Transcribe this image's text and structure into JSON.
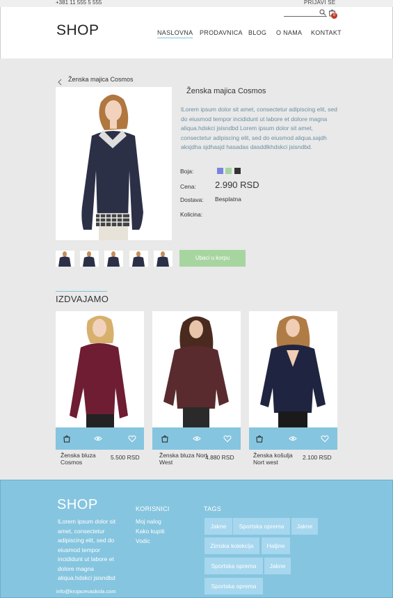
{
  "topbar": {
    "phone": "+381 11 555 5 555",
    "login": "PRIJAVI SE"
  },
  "header": {
    "logo": "SHOP",
    "cart_count": "0",
    "nav": [
      "NASLOVNA",
      "PRODAVNICA",
      "BLOG",
      "O NAMA",
      "KONTAKT"
    ],
    "active_nav": "NASLOVNA"
  },
  "product": {
    "breadcrumb": "Ženska majica Cosmos",
    "title": "Ženska majica Cosmos",
    "description": "lLorem ipsum dolor sit amet, consectetur adipiscing elit, sed do eiusmod tempor incididunt ut labore et dolore magna aliqua.hdskci jsisndbd Lorem ipsum dolor sit amet, consectetur adipiscing elit, sed do eiusmod aliqua.sajdh aksjdha sjdhasjd hasadas dasddlkhdskci jsisndbd.",
    "color_label": "Boja:",
    "colors": [
      "#7b83e0",
      "#a6d59f",
      "#333333"
    ],
    "price_label": "Cena:",
    "price": "2.990 RSD",
    "shipping_label": "Dostava:",
    "shipping": "Besplatna",
    "quantity_label": "Kolicina:",
    "add_to_cart": "Ubaci u korpu"
  },
  "featured": {
    "title": "IZDVAJAMO",
    "items": [
      {
        "name": "Ženska bluza Cosmos",
        "price": "5.500 RSD"
      },
      {
        "name": "Ženska bluza Nort West",
        "price": "4.880 RSD"
      },
      {
        "name": "Ženska košulja Nort west",
        "price": "2.100 RSD"
      }
    ]
  },
  "footer": {
    "logo": "SHOP",
    "description": "lLorem ipsum dolor sit amet, consectetur adipiscing elit, sed do eiusmod tempor incididunt ut labore et dolore magna aliqua.hdskci jsisndbd",
    "email": "info@krojacevaskola.com",
    "users_title": "KORISNICI",
    "users_links": [
      "Moj nalog",
      "Kako kupiti",
      "Vodic"
    ],
    "tags_title": "TAGS",
    "tags": [
      "Jakne",
      "Sportska oprema",
      "Jakne",
      "Zimska kolekcija",
      "Haljine",
      "Sportska oprema",
      "Jakne",
      "Sportska oprema"
    ]
  }
}
